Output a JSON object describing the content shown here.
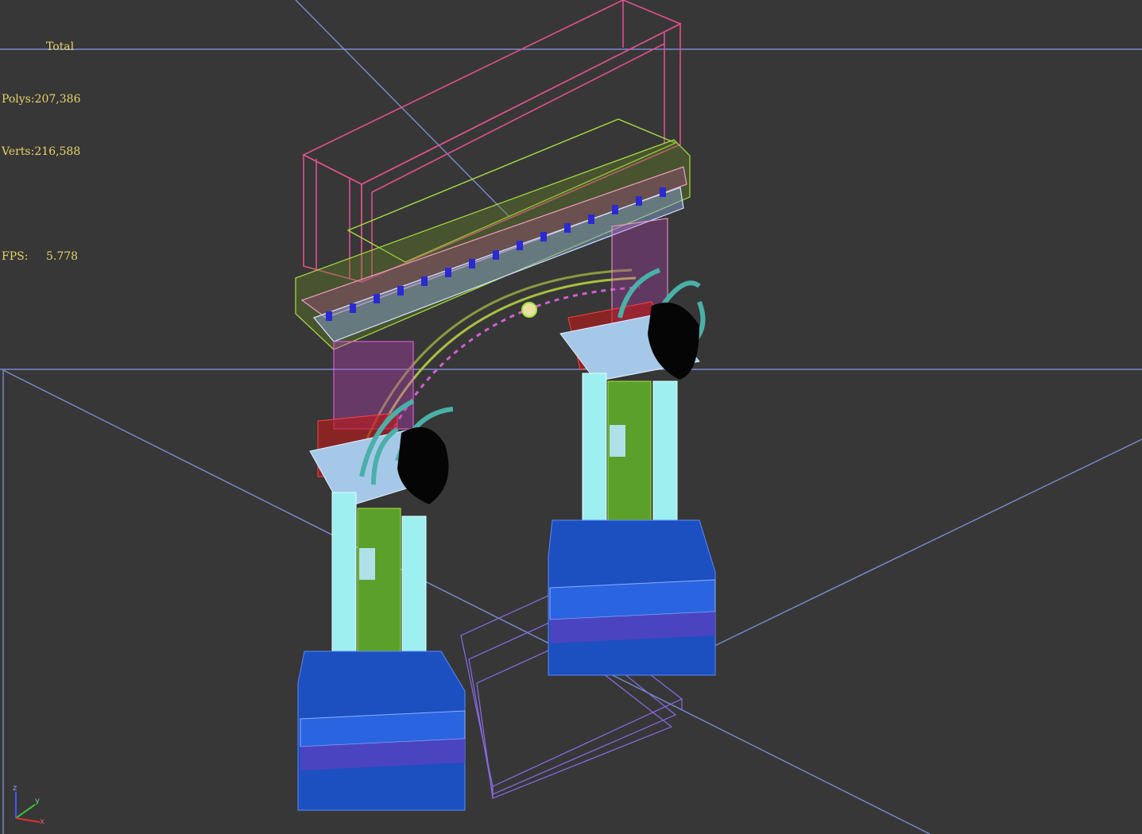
{
  "viewport": {
    "name": "3D perspective viewport",
    "stats": {
      "header": "Total",
      "polys_label": "Polys:",
      "polys_value": "207,386",
      "verts_label": "Verts:",
      "verts_value": "216,588",
      "fps_label": "FPS:",
      "fps_value": "5.778"
    },
    "axes": {
      "x": "x",
      "y": "y",
      "z": "z"
    }
  },
  "colors": {
    "background": "#373737",
    "grid": "#7a8ccf",
    "stats_text": "#e8d36a",
    "attic": "#e0508a",
    "cornice": "#a8e040",
    "columns": "#9ef0f0",
    "pier": "#5aa02a",
    "base": "#1c4fc0",
    "stairs": "#8a6ce8",
    "capital": "#a6c8e8",
    "red_detail": "#c01818",
    "foliage": "#4ab0a8"
  }
}
